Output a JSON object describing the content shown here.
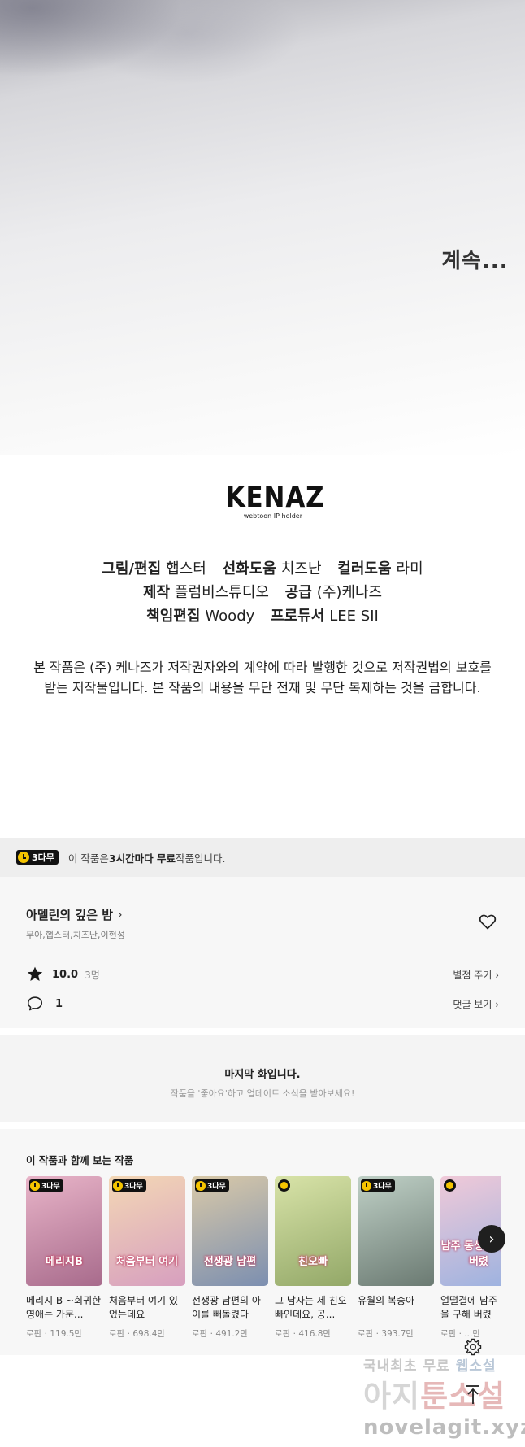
{
  "hero": {
    "continue_text": "계속..."
  },
  "logo": {
    "name": "KENAZ",
    "tagline": "webtoon IP holder"
  },
  "credits": {
    "line1": [
      {
        "role": "그림/편집",
        "name": "햅스터"
      },
      {
        "role": "선화도움",
        "name": "치즈난"
      },
      {
        "role": "컬러도움",
        "name": "라미"
      }
    ],
    "line2": [
      {
        "role": "제작",
        "name": "플럼비스튜디오"
      },
      {
        "role": "공급",
        "name": "(주)케나즈"
      }
    ],
    "line3": [
      {
        "role": "책임편집",
        "name": "Woody"
      },
      {
        "role": "프로듀서",
        "name": "LEE SII"
      }
    ]
  },
  "notice": {
    "line1": "본 작품은 (주) 케나즈가 저작권자와의 계약에 따라 발행한 것으로 저작권법의 보호를",
    "line2": "받는 저작물입니다. 본 작품의 내용을 무단 전재 및 무단 복제하는 것을 금합니다."
  },
  "free_bar": {
    "badge": "3다무",
    "text_pre": "이 작품은 ",
    "text_bold": "3시간마다 무료",
    "text_post": " 작품입니다."
  },
  "work": {
    "title": "아델린의 깊은 밤",
    "authors": "무아,햅스터,치즈난,이현성",
    "rating": "10.0",
    "rating_count": "3명",
    "rate_link": "별점 주기 ›",
    "comment_count": "1",
    "comment_link": "댓글 보기 ›"
  },
  "last_episode": {
    "title": "마지막 화입니다.",
    "subtitle": "작품을 '좋아요'하고 업데이트 소식을 받아보세요!"
  },
  "recommend": {
    "heading": "이 작품과 함께 보는 작품",
    "items": [
      {
        "title": "메리지 B ~회귀한 영애는 가문...",
        "genre": "로판",
        "views": "119.5만",
        "badge": "3다무",
        "cover_text": "메리지B",
        "color_a": "#e8b4c8",
        "color_b": "#a86b8c"
      },
      {
        "title": "처음부터 여기 있었는데요",
        "genre": "로판",
        "views": "698.4만",
        "badge": "3다무",
        "cover_text": "처음부터 여기",
        "color_a": "#f3d7b5",
        "color_b": "#d79fbf"
      },
      {
        "title": "전쟁광 남편의 아이를 빼돌렸다",
        "genre": "로판",
        "views": "491.2만",
        "badge": "3다무",
        "cover_text": "전쟁광 남편",
        "color_a": "#d9c9a8",
        "color_b": "#7c8fb0"
      },
      {
        "title": "그 남자는 제 친오빠인데요, 공...",
        "genre": "로판",
        "views": "416.8만",
        "badge": "",
        "cover_text": "친오빠",
        "color_a": "#d8e3a8",
        "color_b": "#93a868"
      },
      {
        "title": "유월의 복숭아",
        "genre": "로판",
        "views": "393.7만",
        "badge": "3다무",
        "cover_text": "",
        "color_a": "#bfd0c6",
        "color_b": "#6b7a72"
      },
      {
        "title": "얼떨결에 남주 생을 구해 버렸",
        "genre": "로판",
        "views": "...만",
        "badge": "",
        "cover_text": "남주 동생을 구해 버렸",
        "color_a": "#f0c9d8",
        "color_b": "#9bb2e0"
      }
    ]
  },
  "watermark": {
    "line1_a": "국내최초 무료",
    "line1_b": "웹소설",
    "line2_a": "아지",
    "line2_b": "툰소설",
    "line3": "novelagit.xyz"
  },
  "colors": {
    "accent_yellow": "#f5c400",
    "badge_black": "#111111",
    "bg_gray": "#f7f7f7"
  }
}
